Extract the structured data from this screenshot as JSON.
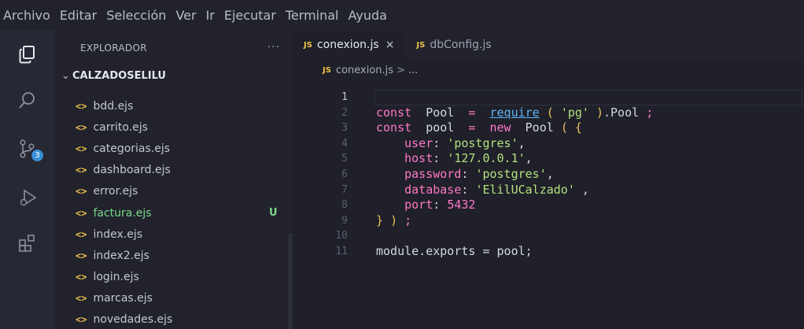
{
  "menu": [
    "Archivo",
    "Editar",
    "Selección",
    "Ver",
    "Ir",
    "Ejecutar",
    "Terminal",
    "Ayuda"
  ],
  "activity_icons": [
    "files-icon",
    "search-icon",
    "source-control-icon",
    "run-debug-icon",
    "extensions-icon"
  ],
  "source_control_badge": "3",
  "sidebar": {
    "title": "EXPLORADOR",
    "more": "···",
    "folder": "CALZADOSELILU",
    "files": [
      {
        "name": "bdd.ejs",
        "status": ""
      },
      {
        "name": "carrito.ejs",
        "status": ""
      },
      {
        "name": "categorias.ejs",
        "status": ""
      },
      {
        "name": "dashboard.ejs",
        "status": ""
      },
      {
        "name": "error.ejs",
        "status": ""
      },
      {
        "name": "factura.ejs",
        "status": "U"
      },
      {
        "name": "index.ejs",
        "status": ""
      },
      {
        "name": "index2.ejs",
        "status": ""
      },
      {
        "name": "login.ejs",
        "status": ""
      },
      {
        "name": "marcas.ejs",
        "status": ""
      },
      {
        "name": "novedades.ejs",
        "status": ""
      }
    ],
    "file_icon": "<>"
  },
  "editor": {
    "tabs": [
      {
        "badge": "JS",
        "label": "conexion.js",
        "close": "×"
      },
      {
        "badge": "JS",
        "label": "dbConfig.js"
      }
    ],
    "breadcrumb": {
      "badge": "JS",
      "file": "conexion.js",
      "sep": ">",
      "rest": "..."
    },
    "line_numbers": [
      "1",
      "2",
      "3",
      "4",
      "5",
      "6",
      "7",
      "8",
      "9",
      "10",
      "11"
    ],
    "lines": [
      "",
      "const  Pool  =  require ( 'pg' ).Pool ;",
      "const  pool  =  new  Pool ( {",
      "    user: 'postgres',",
      "    host: '127.0.0.1',",
      "    password: 'postgres',",
      "    database: 'ElilUCalzado' ,",
      "    port: 5432",
      "} ) ;",
      "",
      "module.exports = pool;"
    ]
  },
  "colors": {
    "keyword": "#ff79c6",
    "string": "#b3e07f",
    "function": "#5fb4f6",
    "punctuation": "#e9c15d",
    "modified": "#7ad88a",
    "js_badge": "#f0c24a"
  }
}
